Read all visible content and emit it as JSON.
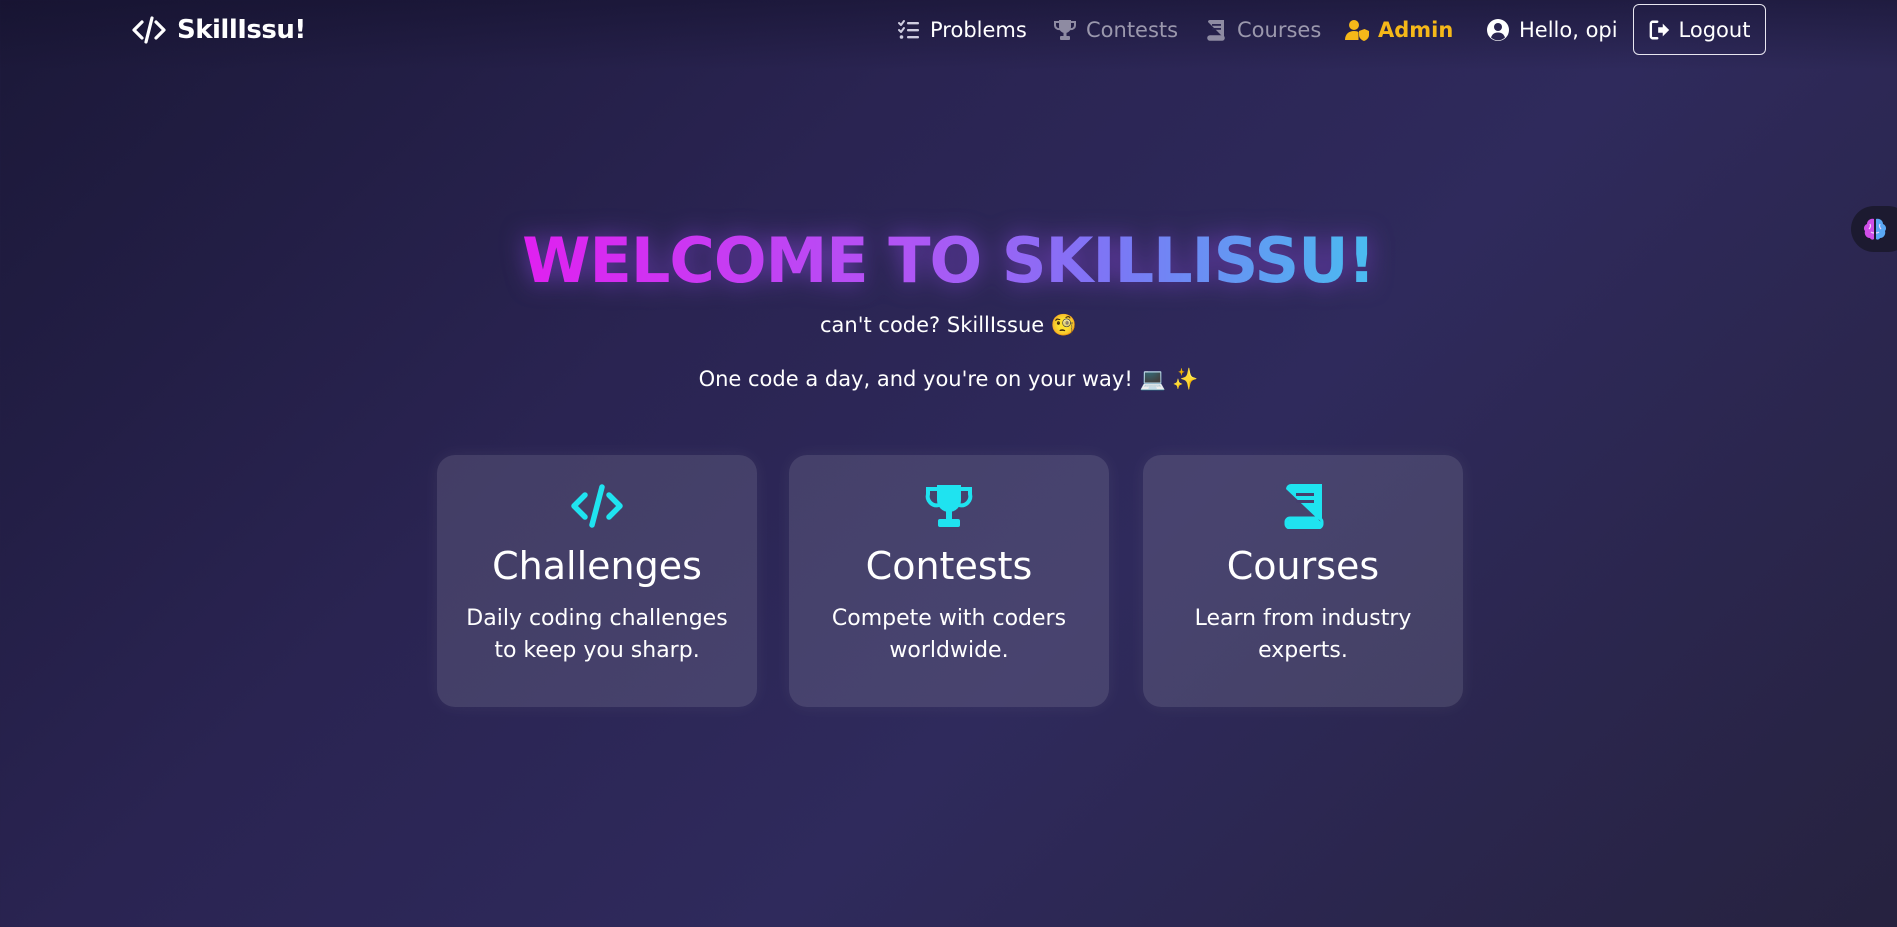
{
  "brand": {
    "name": "SkillIssu!",
    "icon": "code-icon"
  },
  "nav": {
    "problems": {
      "label": "Problems",
      "icon": "list-check-icon"
    },
    "contests": {
      "label": "Contests",
      "icon": "trophy-icon"
    },
    "courses": {
      "label": "Courses",
      "icon": "book-icon"
    },
    "admin": {
      "label": "Admin",
      "icon": "user-shield-icon"
    },
    "hello": {
      "label": "Hello, opi",
      "icon": "user-circle-icon"
    },
    "logout": {
      "label": "Logout",
      "icon": "sign-out-icon"
    }
  },
  "hero": {
    "title": "WELCOME TO SKILLISSU!",
    "tagline": "can't code? SkillIssue 🧐",
    "motto": "One code a day, and you're on your way! 💻 ✨"
  },
  "cards": [
    {
      "title": "Challenges",
      "description": "Daily coding challenges to keep you sharp.",
      "icon": "code-icon"
    },
    {
      "title": "Contests",
      "description": "Compete with coders worldwide.",
      "icon": "trophy-icon"
    },
    {
      "title": "Courses",
      "description": "Learn from industry experts.",
      "icon": "book-icon"
    }
  ],
  "side_widget": {
    "icon": "brain-icon"
  },
  "colors": {
    "accent_cyan": "#1fe3f0",
    "admin_gold": "#f5b819",
    "title_gradient_start": "#e020f0",
    "title_gradient_end": "#49bdf0",
    "muted_nav": "#9b98ad"
  }
}
